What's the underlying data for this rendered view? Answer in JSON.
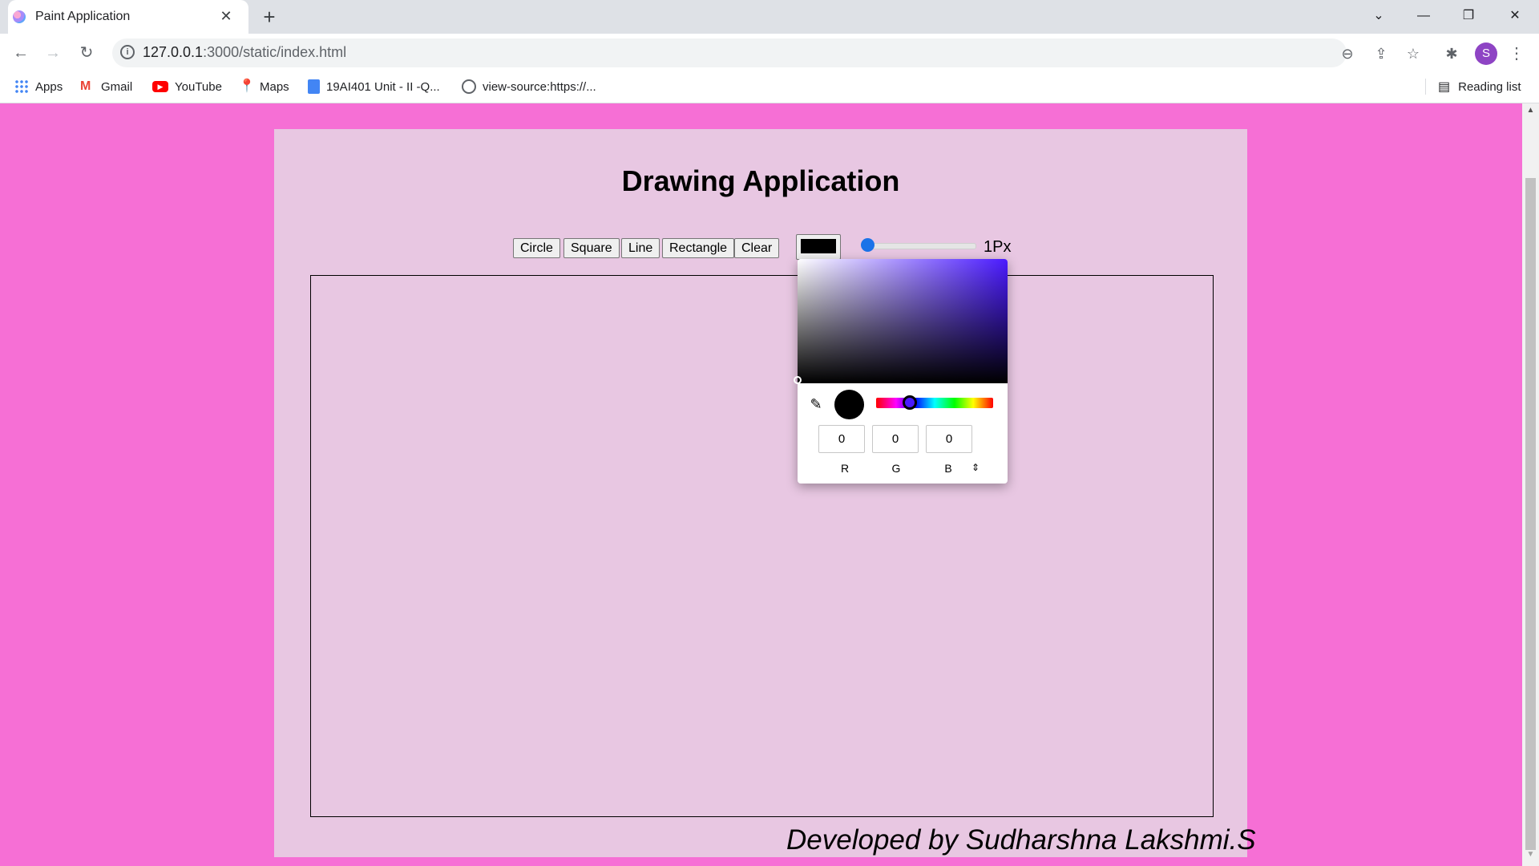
{
  "browser": {
    "tab_title": "Paint Application",
    "url_host": "127.0.0.1",
    "url_path": ":3000/static/index.html",
    "avatar_letter": "S",
    "bookmarks": [
      "Apps",
      "Gmail",
      "YouTube",
      "Maps",
      "19AI401 Unit - II -Q...",
      "view-source:https://..."
    ],
    "reading_list": "Reading list"
  },
  "page": {
    "title": "Drawing Application",
    "tools": [
      "Circle",
      "Square",
      "Line",
      "Rectangle",
      "Clear"
    ],
    "selected_color": "#000000",
    "brush_size": 1,
    "size_label": "1Px",
    "footer": "Developed by Sudharshna Lakshmi.S",
    "background_color": "#f66fd5",
    "container_color": "#e8c7e2"
  },
  "color_picker": {
    "r": "0",
    "g": "0",
    "b": "0",
    "labels": [
      "R",
      "G",
      "B"
    ],
    "hue_color": "#4a1aff"
  }
}
